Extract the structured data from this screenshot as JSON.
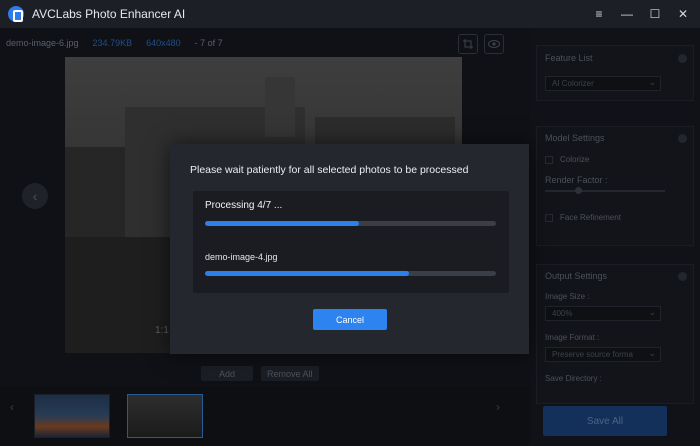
{
  "app": {
    "title": "AVCLabs Photo Enhancer AI",
    "logo_icon": "app-logo-icon"
  },
  "window_controls": {
    "menu": "≡",
    "minimize": "—",
    "maximize": "☐",
    "close": "✕"
  },
  "infobar": {
    "filename": "demo-image-6.jpg",
    "filesize": "234.79KB",
    "resolution": "640x480",
    "position": "- 7 of 7"
  },
  "preview": {
    "page_indicator": "1:1"
  },
  "actions": {
    "add_label": "Add",
    "remove_all_label": "Remove All"
  },
  "right_panel": {
    "feature_list": {
      "title": "Feature List",
      "selected": "AI Colorizer"
    },
    "model_settings": {
      "title": "Model Settings",
      "colorize_label": "Colorize",
      "render_factor_label": "Render Factor :",
      "face_refinement_label": "Face Refinement"
    },
    "output_settings": {
      "title": "Output Settings",
      "image_size_label": "Image Size :",
      "image_size_value": "400%",
      "image_format_label": "Image Format :",
      "image_format_value": "Preserve source forma",
      "save_directory_label": "Save Directory :"
    },
    "save_all_label": "Save All"
  },
  "modal": {
    "message": "Please wait patiently for all selected photos to be processed",
    "processing_label": "Processing 4/7 ...",
    "overall_progress": 0.53,
    "current_file": "demo-image-4.jpg",
    "file_progress": 0.7,
    "cancel_label": "Cancel"
  },
  "colors": {
    "accent": "#2d83ef",
    "modal_bg": "#24272e",
    "bar_track": "#3a3e46"
  }
}
